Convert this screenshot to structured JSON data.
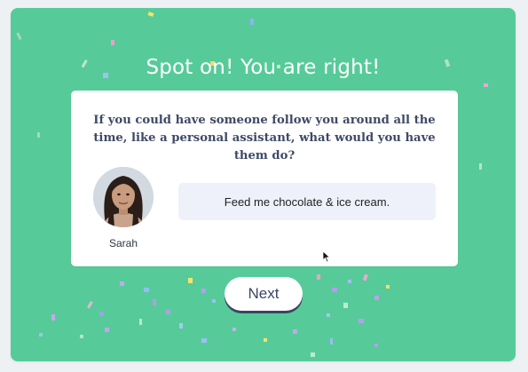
{
  "headline": "Spot on! You are right!",
  "question": "If you could have someone follow you around all the time, like a personal assistant, what would you have them do?",
  "person": {
    "name": "Sarah",
    "avatar_icon": "woman-portrait-avatar"
  },
  "answer": "Feed me chocolate & ice cream.",
  "next_label": "Next",
  "colors": {
    "background": "#56cb99",
    "card": "#ffffff",
    "question_text": "#3e4a66",
    "answer_bg": "#eef1f9",
    "button_shadow": "#3a4563"
  }
}
